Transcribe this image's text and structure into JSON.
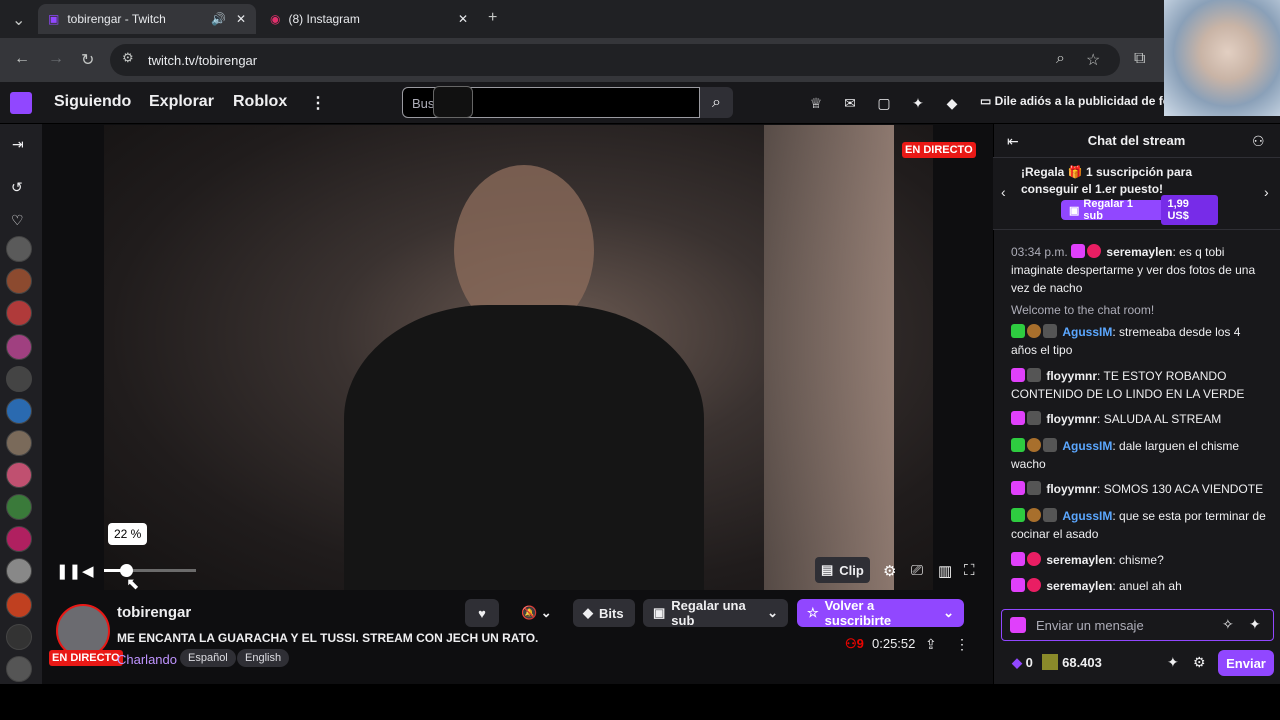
{
  "browser": {
    "tabs": [
      {
        "title": "tobirengar - Twitch",
        "active": true
      },
      {
        "title": "(8) Instagram",
        "active": false
      }
    ],
    "url": "twitch.tv/tobirengar"
  },
  "nav": {
    "links": [
      "Siguiendo",
      "Explorar",
      "Roblox"
    ],
    "search_placeholder": "Bus",
    "ad_text": "Dile adiós a la publicidad de fo"
  },
  "player": {
    "live_label": "EN DIRECTO",
    "volume_tooltip": "22 %",
    "volume_level": 0.22,
    "clip_label": "Clip"
  },
  "channel": {
    "name": "tobirengar",
    "live_label": "EN DIRECTO",
    "title": "ME ENCANTA LA GUARACHA Y EL TUSSI. STREAM CON JECH UN RATO.",
    "category": "Charlando",
    "tags": [
      "Español",
      "English"
    ],
    "bits_label": "Bits",
    "gift_label": "Regalar una sub",
    "resub_label": "Volver a suscribirte",
    "viewers": "9",
    "uptime": "0:25:52"
  },
  "chat": {
    "header": "Chat del stream",
    "promo_text": "¡Regala 🎁 1 suscripción para conseguir el 1.er puesto!",
    "promo_button": "Regalar 1 sub",
    "promo_price": "1,99 US$",
    "messages": [
      {
        "time": "03:34 p.m.",
        "user": "seremaylen",
        "color": "#ffffff",
        "text": ": es q tobi imaginate despertarme y ver dos fotos de una vez de nacho"
      },
      {
        "system": "Welcome to the chat room!"
      },
      {
        "user": "AgussIM",
        "color": "#5ba7ff",
        "text": ": stremeaba desde los 4 años el tipo"
      },
      {
        "user": "floyymnr",
        "color": "#ffffff",
        "text": ": TE ESTOY ROBANDO CONTENIDO DE LO LINDO EN LA VERDE"
      },
      {
        "user": "floyymnr",
        "color": "#ffffff",
        "text": ": SALUDA AL STREAM"
      },
      {
        "user": "AgussIM",
        "color": "#5ba7ff",
        "text": ": dale larguen el chisme wacho"
      },
      {
        "user": "floyymnr",
        "color": "#ffffff",
        "text": ": SOMOS 130 ACA VIENDOTE"
      },
      {
        "user": "AgussIM",
        "color": "#5ba7ff",
        "text": ": que se esta por terminar de cocinar el asado"
      },
      {
        "user": "seremaylen",
        "color": "#ffffff",
        "text": ": chisme?"
      },
      {
        "user": "seremaylen",
        "color": "#ffffff",
        "text": ": anuel ah ah"
      }
    ],
    "input_placeholder": "Enviar un mensaje",
    "bits_count": "0",
    "points": "68.403",
    "send_label": "Enviar"
  }
}
